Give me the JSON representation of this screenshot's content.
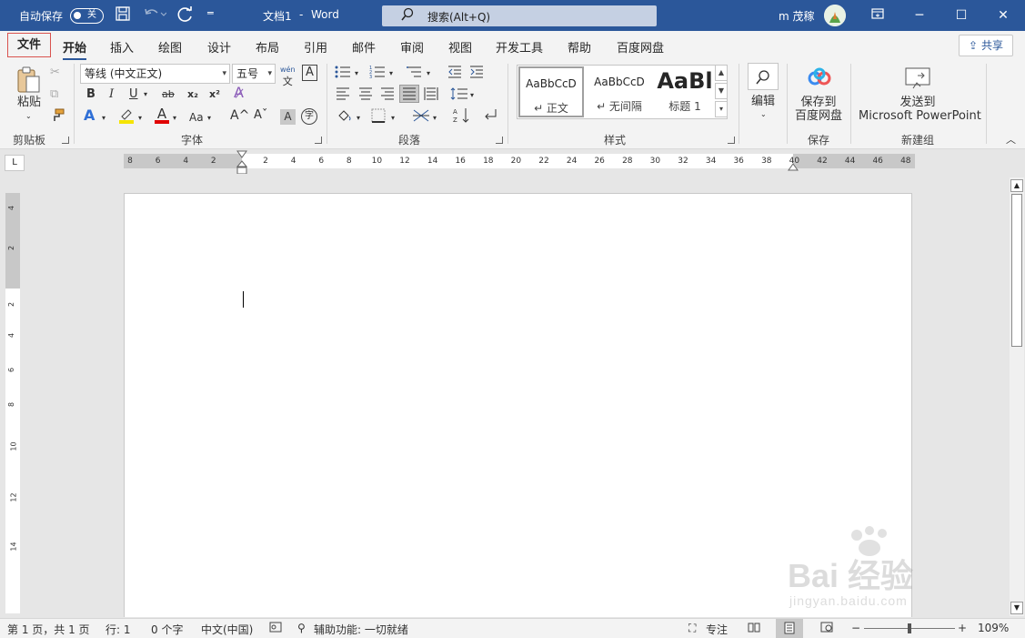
{
  "titlebar": {
    "autosave_label": "自动保存",
    "autosave_state": "关",
    "document_title": "文档1",
    "separator": "-",
    "app_name": "Word",
    "search_placeholder": "搜索(Alt+Q)",
    "user_name": "m 茂稼",
    "accent_color": "#2b579a"
  },
  "tabs": {
    "file": "文件",
    "home": "开始",
    "insert": "插入",
    "draw": "绘图",
    "design": "设计",
    "layout": "布局",
    "references": "引用",
    "mailings": "邮件",
    "review": "审阅",
    "view": "视图",
    "developer": "开发工具",
    "help": "帮助",
    "baidu_disk": "百度网盘",
    "share": "共享",
    "active": "开始"
  },
  "ribbon": {
    "clipboard": {
      "paste": "粘贴",
      "label": "剪贴板"
    },
    "font": {
      "font_name": "等线 (中文正文)",
      "font_size": "五号",
      "phonetic": "wén",
      "phonetic_char": "文",
      "label": "字体",
      "bold": "B",
      "italic": "I",
      "underline": "U",
      "strike": "ab",
      "subscript": "x₂",
      "superscript": "x²",
      "change_case": "Aa",
      "grow": "A^",
      "shrink": "Aˇ",
      "char_shade": "A"
    },
    "paragraph": {
      "label": "段落"
    },
    "styles": {
      "label": "样式",
      "items": [
        {
          "preview": "AaBbCcD",
          "name": "↵ 正文"
        },
        {
          "preview": "AaBbCcD",
          "name": "↵ 无间隔"
        },
        {
          "preview": "AaBl",
          "name": "标题 1"
        }
      ]
    },
    "editing": {
      "label": "编辑"
    },
    "save": {
      "button": "保存到",
      "button2": "百度网盘",
      "label": "保存"
    },
    "newgroup": {
      "button": "发送到",
      "button2": "Microsoft PowerPoint",
      "label": "新建组"
    }
  },
  "ruler": {
    "ticks": [
      "8",
      "6",
      "4",
      "2",
      "2",
      "4",
      "6",
      "8",
      "10",
      "12",
      "14",
      "16",
      "18",
      "20",
      "22",
      "24",
      "26",
      "28",
      "30",
      "32",
      "34",
      "36",
      "38",
      "40",
      "42",
      "44",
      "46",
      "48"
    ],
    "corner": "L"
  },
  "vruler": {
    "ticks": [
      "4",
      "2",
      "2",
      "4",
      "6",
      "8",
      "10",
      "12",
      "14"
    ]
  },
  "status": {
    "page": "第 1 页，共 1 页",
    "line": "行: 1",
    "words": "0 个字",
    "language": "中文(中国)",
    "accessibility": "辅助功能: 一切就绪",
    "focus": "专注",
    "zoom_minus": "−",
    "zoom_plus": "+",
    "zoom": "109%",
    "zoom_level": 1.09
  },
  "watermark": {
    "text": "Bai 经验",
    "url_text": "jingyan.baidu.com"
  }
}
